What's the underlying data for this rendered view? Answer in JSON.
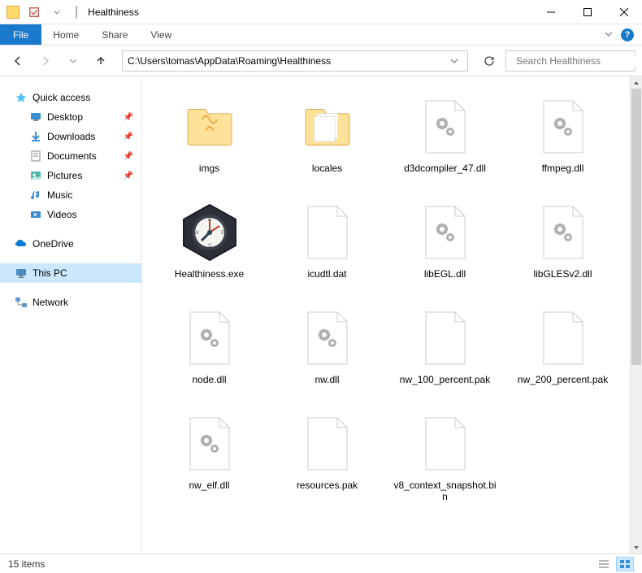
{
  "title": {
    "app_name": "Healthiness",
    "separator": "|"
  },
  "ribbon": {
    "file": "File",
    "tabs": [
      "Home",
      "Share",
      "View"
    ]
  },
  "navbar": {
    "path": "C:\\Users\\tomas\\AppData\\Roaming\\Healthiness",
    "search_placeholder": "Search Healthiness"
  },
  "sidebar": {
    "quick_access": "Quick access",
    "items_pinned": [
      {
        "label": "Desktop",
        "icon": "desktop"
      },
      {
        "label": "Downloads",
        "icon": "downloads"
      },
      {
        "label": "Documents",
        "icon": "documents"
      },
      {
        "label": "Pictures",
        "icon": "pictures"
      }
    ],
    "items_recent": [
      {
        "label": "Music",
        "icon": "music"
      },
      {
        "label": "Videos",
        "icon": "videos"
      }
    ],
    "onedrive": "OneDrive",
    "thispc": "This PC",
    "network": "Network"
  },
  "files": [
    {
      "name": "imgs",
      "type": "folder-special"
    },
    {
      "name": "locales",
      "type": "folder"
    },
    {
      "name": "d3dcompiler_47.dll",
      "type": "dll"
    },
    {
      "name": "ffmpeg.dll",
      "type": "dll"
    },
    {
      "name": "Healthiness.exe",
      "type": "exe"
    },
    {
      "name": "icudtl.dat",
      "type": "file"
    },
    {
      "name": "libEGL.dll",
      "type": "dll"
    },
    {
      "name": "libGLESv2.dll",
      "type": "dll"
    },
    {
      "name": "node.dll",
      "type": "dll"
    },
    {
      "name": "nw.dll",
      "type": "dll"
    },
    {
      "name": "nw_100_percent.pak",
      "type": "file"
    },
    {
      "name": "nw_200_percent.pak",
      "type": "file"
    },
    {
      "name": "nw_elf.dll",
      "type": "dll"
    },
    {
      "name": "resources.pak",
      "type": "file"
    },
    {
      "name": "v8_context_snapshot.bin",
      "type": "file"
    }
  ],
  "status": {
    "item_count": "15 items"
  }
}
